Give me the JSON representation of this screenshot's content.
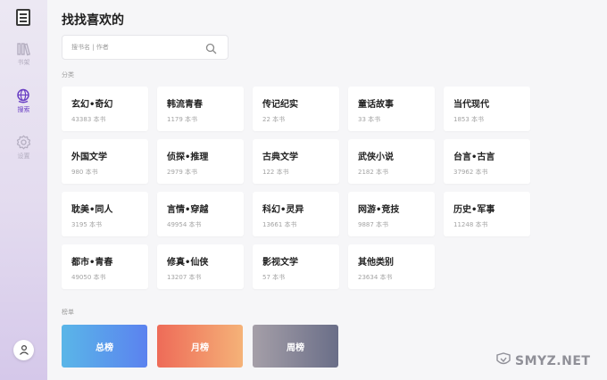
{
  "sidebar": {
    "items": [
      {
        "label": "书架",
        "icon": "bookshelf-icon"
      },
      {
        "label": "搜索",
        "icon": "globe-search-icon"
      },
      {
        "label": "设置",
        "icon": "gear-icon"
      }
    ],
    "active": "搜索"
  },
  "header": {
    "title": "找找喜欢的"
  },
  "search": {
    "placeholder": "搜书名 | 作者",
    "value": ""
  },
  "sections": {
    "categories": "分类",
    "ranks": "榜单"
  },
  "categories": [
    {
      "name": "玄幻•奇幻",
      "count": "43383 本书"
    },
    {
      "name": "韩流青春",
      "count": "1179 本书"
    },
    {
      "name": "传记纪实",
      "count": "22 本书"
    },
    {
      "name": "童话故事",
      "count": "33 本书"
    },
    {
      "name": "当代现代",
      "count": "1853 本书"
    },
    {
      "name": "外国文学",
      "count": "980 本书"
    },
    {
      "name": "侦探•推理",
      "count": "2979 本书"
    },
    {
      "name": "古典文学",
      "count": "122 本书"
    },
    {
      "name": "武侠小说",
      "count": "2182 本书"
    },
    {
      "name": "台言•古言",
      "count": "37962 本书"
    },
    {
      "name": "耽美•同人",
      "count": "3195 本书"
    },
    {
      "name": "言情•穿越",
      "count": "49954 本书"
    },
    {
      "name": "科幻•灵异",
      "count": "13661 本书"
    },
    {
      "name": "网游•竞技",
      "count": "9887 本书"
    },
    {
      "name": "历史•军事",
      "count": "11248 本书"
    },
    {
      "name": "都市•青春",
      "count": "49050 本书"
    },
    {
      "name": "修真•仙侠",
      "count": "13207 本书"
    },
    {
      "name": "影视文学",
      "count": "57 本书"
    },
    {
      "name": "其他类别",
      "count": "23634 本书"
    }
  ],
  "ranks": [
    {
      "label": "总榜"
    },
    {
      "label": "月榜"
    },
    {
      "label": "周榜"
    }
  ],
  "watermark": "SMYZ.NET",
  "colors": {
    "accent": "#6a3fc4",
    "rank_total": [
      "#5ab6e8",
      "#5b82ef"
    ],
    "rank_month": [
      "#ee6b58",
      "#f5b278"
    ],
    "rank_week": [
      "#a59fa8",
      "#6a6e88"
    ]
  }
}
